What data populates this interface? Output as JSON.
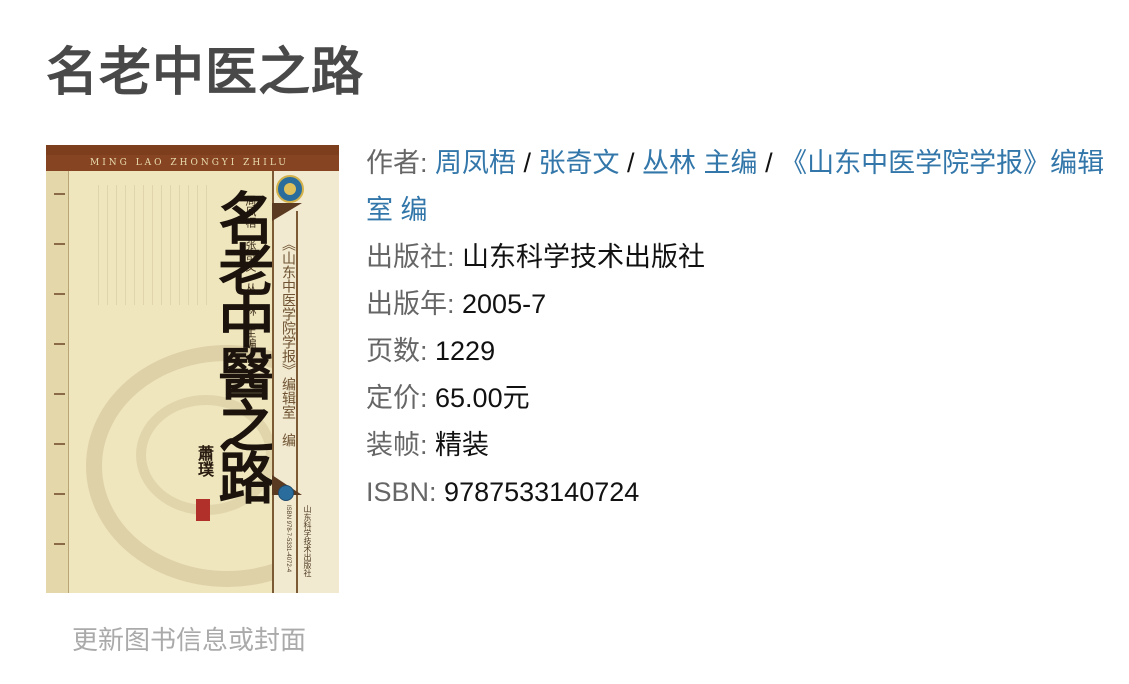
{
  "title": "名老中医之路",
  "cover": {
    "pinyin": "MING LAO ZHONGYI ZHILU",
    "calligraphy_title": "名老中醫之路",
    "authors_vertical": "周凤梧　张奇文　丛　林　主编",
    "journal_vertical": "《山东中医学院学报》编辑室　编",
    "signature": "蕭璞",
    "publisher_vertical": "山东科学技术出版社",
    "isbn_vertical": "ISBN 978-7-5331-4072-4"
  },
  "info": {
    "author_label": "作者",
    "authors": [
      "周凤梧",
      "张奇文",
      "丛林 主编",
      "《山东中医学院学报》编辑室 编"
    ],
    "publisher_label": "出版社",
    "publisher": "山东科学技术出版社",
    "year_label": "出版年",
    "year": "2005-7",
    "pages_label": "页数",
    "pages": "1229",
    "price_label": "定价",
    "price": "65.00元",
    "binding_label": "装帧",
    "binding": "精装",
    "isbn_label": "ISBN",
    "isbn": "9787533140724"
  },
  "update_link": "更新图书信息或封面"
}
